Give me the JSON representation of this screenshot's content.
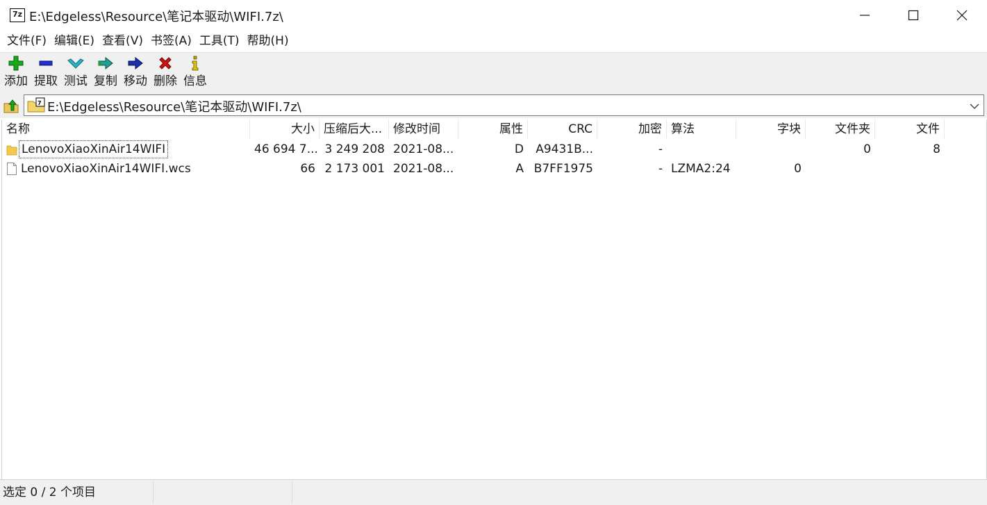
{
  "window": {
    "title": "E:\\Edgeless\\Resource\\笔记本驱动\\WIFI.7z\\",
    "app_icon_text": "7z"
  },
  "menu": [
    "文件(F)",
    "编辑(E)",
    "查看(V)",
    "书签(A)",
    "工具(T)",
    "帮助(H)"
  ],
  "toolbar": {
    "add": "添加",
    "extract": "提取",
    "test": "测试",
    "copy": "复制",
    "move": "移动",
    "delete": "删除",
    "info": "信息"
  },
  "address": {
    "path": "E:\\Edgeless\\Resource\\笔记本驱动\\WIFI.7z\\"
  },
  "columns": [
    "名称",
    "大小",
    "压缩后大...",
    "修改时间",
    "属性",
    "CRC",
    "加密",
    "算法",
    "字块",
    "文件夹",
    "文件"
  ],
  "rows": [
    {
      "name": "LenovoXiaoXinAir14WIFI",
      "icon": "folder-icon",
      "size": "46 694 7...",
      "packed": "3 249 208",
      "modified": "2021-08...",
      "attr": "D",
      "crc": "A9431B...",
      "encrypted": "-",
      "method": "",
      "block": "",
      "folders": "0",
      "files": "8"
    },
    {
      "name": "LenovoXiaoXinAir14WIFI.wcs",
      "icon": "file-icon",
      "size": "66",
      "packed": "2 173 001",
      "modified": "2021-08...",
      "attr": "A",
      "crc": "B7FF1975",
      "encrypted": "-",
      "method": "LZMA2:24",
      "block": "0",
      "folders": "",
      "files": ""
    }
  ],
  "status": {
    "selection": "选定 0 / 2 个项目"
  },
  "colors": {
    "toolbar_bg": "#f0f0f0",
    "add": "#1aa81a",
    "extract": "#1f2fd0",
    "test": "#22b8c8",
    "delete": "#d01010",
    "info": "#c8a800"
  }
}
